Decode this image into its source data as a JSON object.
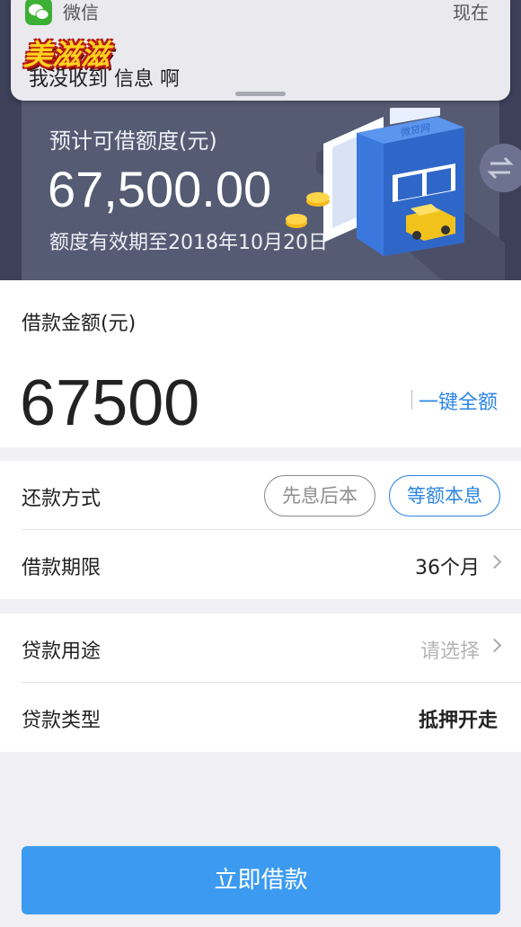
{
  "notification": {
    "app_name": "微信",
    "time": "现在",
    "message": "我没收到 信息 啊",
    "sticker_text": "美滋滋"
  },
  "banner": {
    "quota_label": "预计可借额度(元)",
    "quota_value": "67,500.00",
    "expire_text": "额度有效期至2018年10月20日",
    "building_sign": "微贷网"
  },
  "loan_amount": {
    "label": "借款金额(元)",
    "value": "67500",
    "full_amount_link": "一键全额"
  },
  "repayment": {
    "label": "还款方式",
    "options": [
      "先息后本",
      "等额本息"
    ],
    "selected": "等额本息"
  },
  "term": {
    "label": "借款期限",
    "value": "36个月"
  },
  "purpose": {
    "label": "贷款用途",
    "placeholder": "请选择"
  },
  "loan_type": {
    "label": "贷款类型",
    "value": "抵押开走"
  },
  "submit": {
    "label": "立即借款"
  },
  "colors": {
    "accent": "#2d86e4",
    "button": "#3c9bf0",
    "banner": "#3c4059",
    "wechat": "#3cb034"
  }
}
